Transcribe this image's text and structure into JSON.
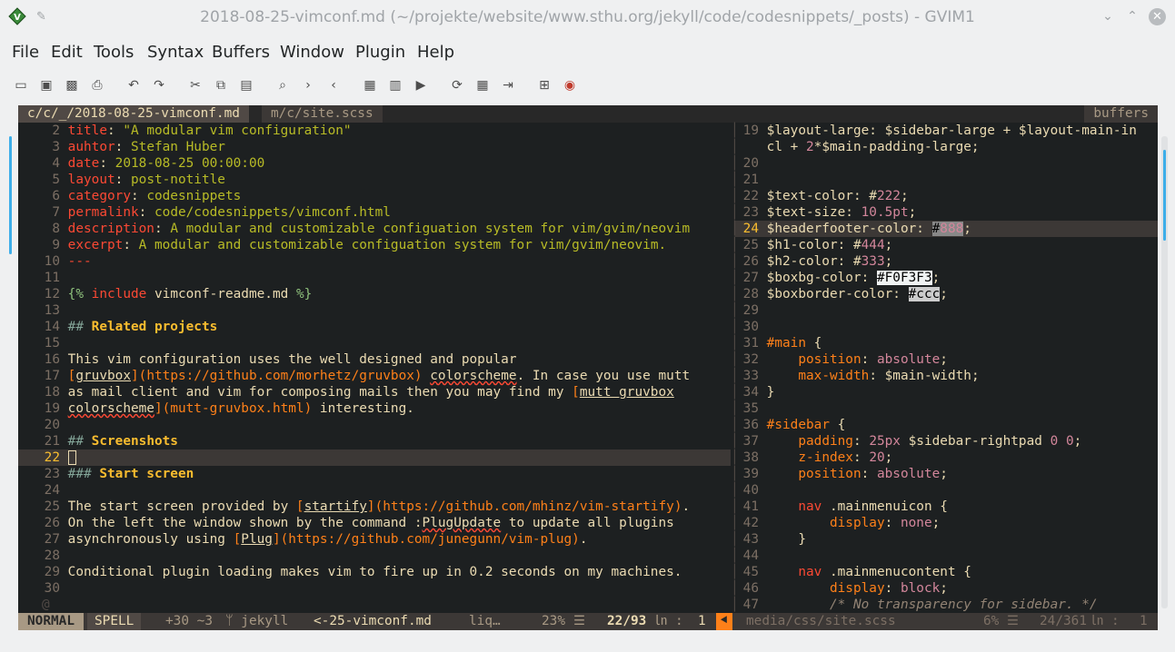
{
  "window": {
    "title": "2018-08-25-vimconf.md (~/projekte/website/www.sthu.org/jekyll/code/codesnippets/_posts) - GVIM1"
  },
  "menu": [
    "File",
    "Edit",
    "Tools",
    "Syntax",
    "Buffers",
    "Window",
    "Plugin",
    "Help"
  ],
  "toolbar_icons": [
    "open-icon",
    "save-icon",
    "save-all-icon",
    "print-icon",
    "undo-icon",
    "redo-icon",
    "cut-icon",
    "copy-icon",
    "paste-icon",
    "find-replace-icon",
    "find-next-icon",
    "find-prev-icon",
    "load-session-icon",
    "save-session-icon",
    "run-script-icon",
    "make-icon",
    "ctags-icon",
    "jump-tag-icon",
    "help-icon",
    "find-help-icon"
  ],
  "tabline": {
    "active": "c/c/_/2018-08-25-vimconf.md",
    "inactive": "m/c/site.scss",
    "buffers": "buffers"
  },
  "left_pane": {
    "cursor_line": 22,
    "lines": [
      {
        "n": "2",
        "t": "title: \"A modular vim configuration\""
      },
      {
        "n": "3",
        "t": "auhtor: Stefan Huber"
      },
      {
        "n": "4",
        "t": "date: 2018-08-25 00:00:00"
      },
      {
        "n": "5",
        "t": "layout: post-notitle"
      },
      {
        "n": "6",
        "t": "category: codesnippets"
      },
      {
        "n": "7",
        "t": "permalink: code/codesnippets/vimconf.html"
      },
      {
        "n": "8",
        "t": "description: A modular and customizable configuation system for vim/gvim/neovim"
      },
      {
        "n": "9",
        "t": "excerpt: A modular and customizable configuation system for vim/gvim/neovim."
      },
      {
        "n": "10",
        "t": "---"
      },
      {
        "n": "11",
        "t": ""
      },
      {
        "n": "12",
        "t": "{% include vimconf-readme.md %}"
      },
      {
        "n": "13",
        "t": ""
      },
      {
        "n": "14",
        "t": "## Related projects"
      },
      {
        "n": "15",
        "t": ""
      },
      {
        "n": "16",
        "t": "This vim configuration uses the well designed and popular"
      },
      {
        "n": "17",
        "t": "[gruvbox](https://github.com/morhetz/gruvbox) colorscheme. In case you use mutt"
      },
      {
        "n": "18",
        "t": "as mail client and vim for composing mails then you may find my [mutt gruvbox"
      },
      {
        "n": "19",
        "t": "colorscheme](mutt-gruvbox.html) interesting."
      },
      {
        "n": "20",
        "t": ""
      },
      {
        "n": "21",
        "t": "## Screenshots"
      },
      {
        "n": "22",
        "t": ""
      },
      {
        "n": "23",
        "t": "### Start screen"
      },
      {
        "n": "24",
        "t": ""
      },
      {
        "n": "25",
        "t": "The start screen provided by [startify](https://github.com/mhinz/vim-startify)."
      },
      {
        "n": "26",
        "t": "On the left the window shown by the command :PlugUpdate to update all plugins"
      },
      {
        "n": "27",
        "t": "asynchronously using [Plug](https://github.com/junegunn/vim-plug)."
      },
      {
        "n": "28",
        "t": ""
      },
      {
        "n": "29",
        "t": "Conditional plugin loading makes vim to fire up in 0.2 seconds on my machines."
      },
      {
        "n": "30",
        "t": ""
      }
    ],
    "filler": "@"
  },
  "right_pane": {
    "cursor_line": 24,
    "lines": [
      {
        "n": "19",
        "t": "$layout-large: $sidebar-large + $layout-main-in"
      },
      {
        "n": "",
        "t": "cl + 2*$main-padding-large;"
      },
      {
        "n": "20",
        "t": ""
      },
      {
        "n": "21",
        "t": ""
      },
      {
        "n": "22",
        "t": "$text-color: #222;"
      },
      {
        "n": "23",
        "t": "$text-size: 10.5pt;"
      },
      {
        "n": "24",
        "t": "$headerfooter-color: #888;"
      },
      {
        "n": "25",
        "t": "$h1-color: #444;"
      },
      {
        "n": "26",
        "t": "$h2-color: #333;"
      },
      {
        "n": "27",
        "t": "$boxbg-color: #F0F3F3;"
      },
      {
        "n": "28",
        "t": "$boxborder-color: #ccc;"
      },
      {
        "n": "29",
        "t": ""
      },
      {
        "n": "30",
        "t": ""
      },
      {
        "n": "31",
        "t": "#main {"
      },
      {
        "n": "32",
        "t": "    position: absolute;"
      },
      {
        "n": "33",
        "t": "    max-width: $main-width;"
      },
      {
        "n": "34",
        "t": "}"
      },
      {
        "n": "35",
        "t": ""
      },
      {
        "n": "36",
        "t": "#sidebar {"
      },
      {
        "n": "37",
        "t": "    padding: 25px $sidebar-rightpad 0 0;"
      },
      {
        "n": "38",
        "t": "    z-index: 20;"
      },
      {
        "n": "39",
        "t": "    position: absolute;"
      },
      {
        "n": "40",
        "t": ""
      },
      {
        "n": "41",
        "t": "    nav .mainmenuicon {"
      },
      {
        "n": "42",
        "t": "        display: none;"
      },
      {
        "n": "43",
        "t": "    }"
      },
      {
        "n": "44",
        "t": ""
      },
      {
        "n": "45",
        "t": "    nav .mainmenucontent {"
      },
      {
        "n": "46",
        "t": "        display: block;"
      },
      {
        "n": "47",
        "t": "        /* No transparency for sidebar. */"
      }
    ]
  },
  "statusline_left": {
    "mode": "NORMAL",
    "spell": "SPELL",
    "changes": "+30 ~3",
    "branch": "ᛘ jekyll",
    "file": "<-25-vimconf.md",
    "ft": "liq…",
    "percent": "23%",
    "pos": "22/93",
    "col": "1"
  },
  "statusline_right": {
    "file": "media/css/site.scss",
    "percent": "6%",
    "pos": "24/361",
    "col": "1"
  }
}
